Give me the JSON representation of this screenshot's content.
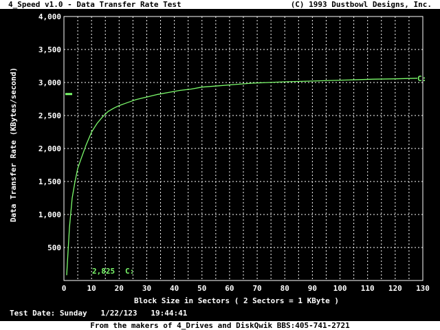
{
  "title_bar": {
    "left": "4_Speed v1.0 - Data Transfer Rate Test",
    "right": "(C) 1993 Dustbowl Designs, Inc."
  },
  "footer": {
    "text": "From the makers of 4_Drives and DiskQwik   BBS:405-741-2721"
  },
  "test_date": {
    "label": "Test Date:",
    "day": "Sunday",
    "date": "1/22/123",
    "time": "19:44:41"
  },
  "colors": {
    "background": "#000000",
    "text": "#ffffff",
    "grid": "#ffffff",
    "curve": "#7cfc6c",
    "bar": "#ffffff"
  },
  "chart_data": {
    "type": "line",
    "xlabel": "Block Size in Sectors ( 2 Sectors = 1 KByte )",
    "ylabel": "Data Transfer Rate (KBytes/second)",
    "xlim": [
      0,
      130
    ],
    "ylim": [
      0,
      4000
    ],
    "x_ticks": [
      "0",
      "10",
      "20",
      "30",
      "40",
      "50",
      "60",
      "70",
      "80",
      "90",
      "100",
      "110",
      "120",
      "130"
    ],
    "y_ticks": [
      "500",
      "1,000",
      "1,500",
      "2,000",
      "2,500",
      "3,000",
      "3,500",
      "4,000"
    ],
    "grid": true,
    "series": [
      {
        "name": "C:",
        "x": [
          1,
          2,
          3,
          4,
          5,
          6,
          8,
          10,
          12,
          14,
          16,
          18,
          20,
          22,
          24,
          26,
          28,
          30,
          34,
          38,
          42,
          46,
          50,
          56,
          62,
          68,
          74,
          80,
          88,
          96,
          104,
          112,
          120,
          128
        ],
        "y": [
          80,
          800,
          1250,
          1500,
          1700,
          1820,
          2050,
          2250,
          2380,
          2480,
          2560,
          2610,
          2650,
          2680,
          2710,
          2740,
          2760,
          2780,
          2820,
          2850,
          2880,
          2900,
          2930,
          2950,
          2970,
          2990,
          3000,
          3010,
          3020,
          3030,
          3040,
          3050,
          3055,
          3065
        ]
      }
    ],
    "end_label": "C:",
    "average": {
      "value": 2825,
      "value_label": "2,825",
      "drive_label": "C:"
    }
  }
}
